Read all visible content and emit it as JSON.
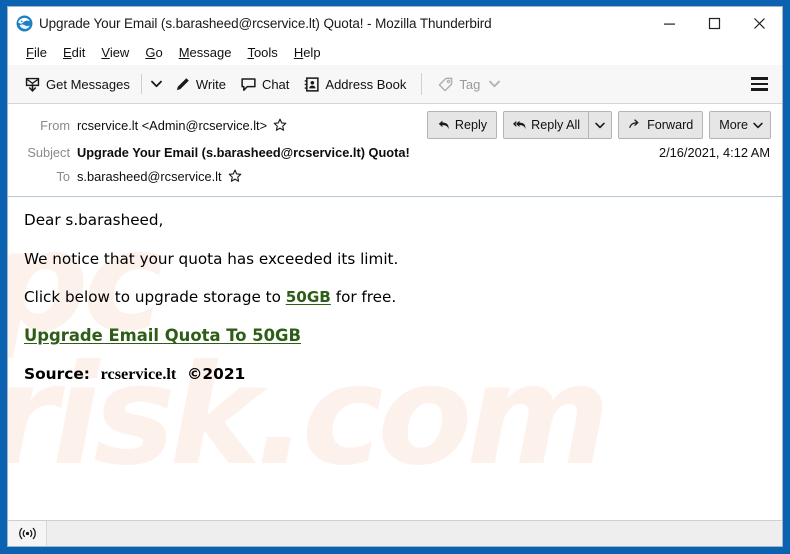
{
  "window": {
    "title": "Upgrade Your Email (s.barasheed@rcservice.lt) Quota! - Mozilla Thunderbird",
    "app_icon": "thunderbird-icon",
    "controls": {
      "minimize": "minimize-icon",
      "maximize": "maximize-icon",
      "close": "close-icon"
    },
    "frame_color": "#0a62b0"
  },
  "menubar": {
    "items": [
      {
        "accel": "F",
        "rest": "ile"
      },
      {
        "accel": "E",
        "rest": "dit"
      },
      {
        "accel": "V",
        "rest": "iew"
      },
      {
        "accel": "G",
        "rest": "o"
      },
      {
        "accel": "M",
        "rest": "essage"
      },
      {
        "accel": "T",
        "rest": "ools"
      },
      {
        "accel": "H",
        "rest": "elp"
      }
    ]
  },
  "toolbar": {
    "get_messages_label": "Get Messages",
    "write_label": "Write",
    "chat_label": "Chat",
    "address_book_label": "Address Book",
    "tag_label": "Tag",
    "tag_disabled": true,
    "menu_label": "app-menu"
  },
  "message_header": {
    "from_label": "From",
    "from_value": "rcservice.lt <Admin@rcservice.lt>",
    "subject_label": "Subject",
    "subject_value": "Upgrade Your Email (s.barasheed@rcservice.lt) Quota!",
    "to_label": "To",
    "to_value": "s.barasheed@rcservice.lt",
    "date": "2/16/2021, 4:12 AM",
    "actions": {
      "reply": "Reply",
      "reply_all": "Reply All",
      "forward": "Forward",
      "more": "More"
    }
  },
  "message_body": {
    "watermark": "pc\nrisk.com",
    "greeting": "Dear s.barasheed,",
    "line_notice": "We notice that your quota has exceeded its limit.",
    "line_click_prefix": "Click below to upgrade storage to ",
    "line_click_highlight": "50GB",
    "line_click_suffix": " for free.",
    "cta_link": "Upgrade Email Quota To 50GB",
    "source_label": "Source:",
    "source_domain": "rcservice.lt",
    "source_copyright": "©2021",
    "link_color": "#2d5d16"
  },
  "statusbar": {
    "icon": "broadcast-icon"
  }
}
